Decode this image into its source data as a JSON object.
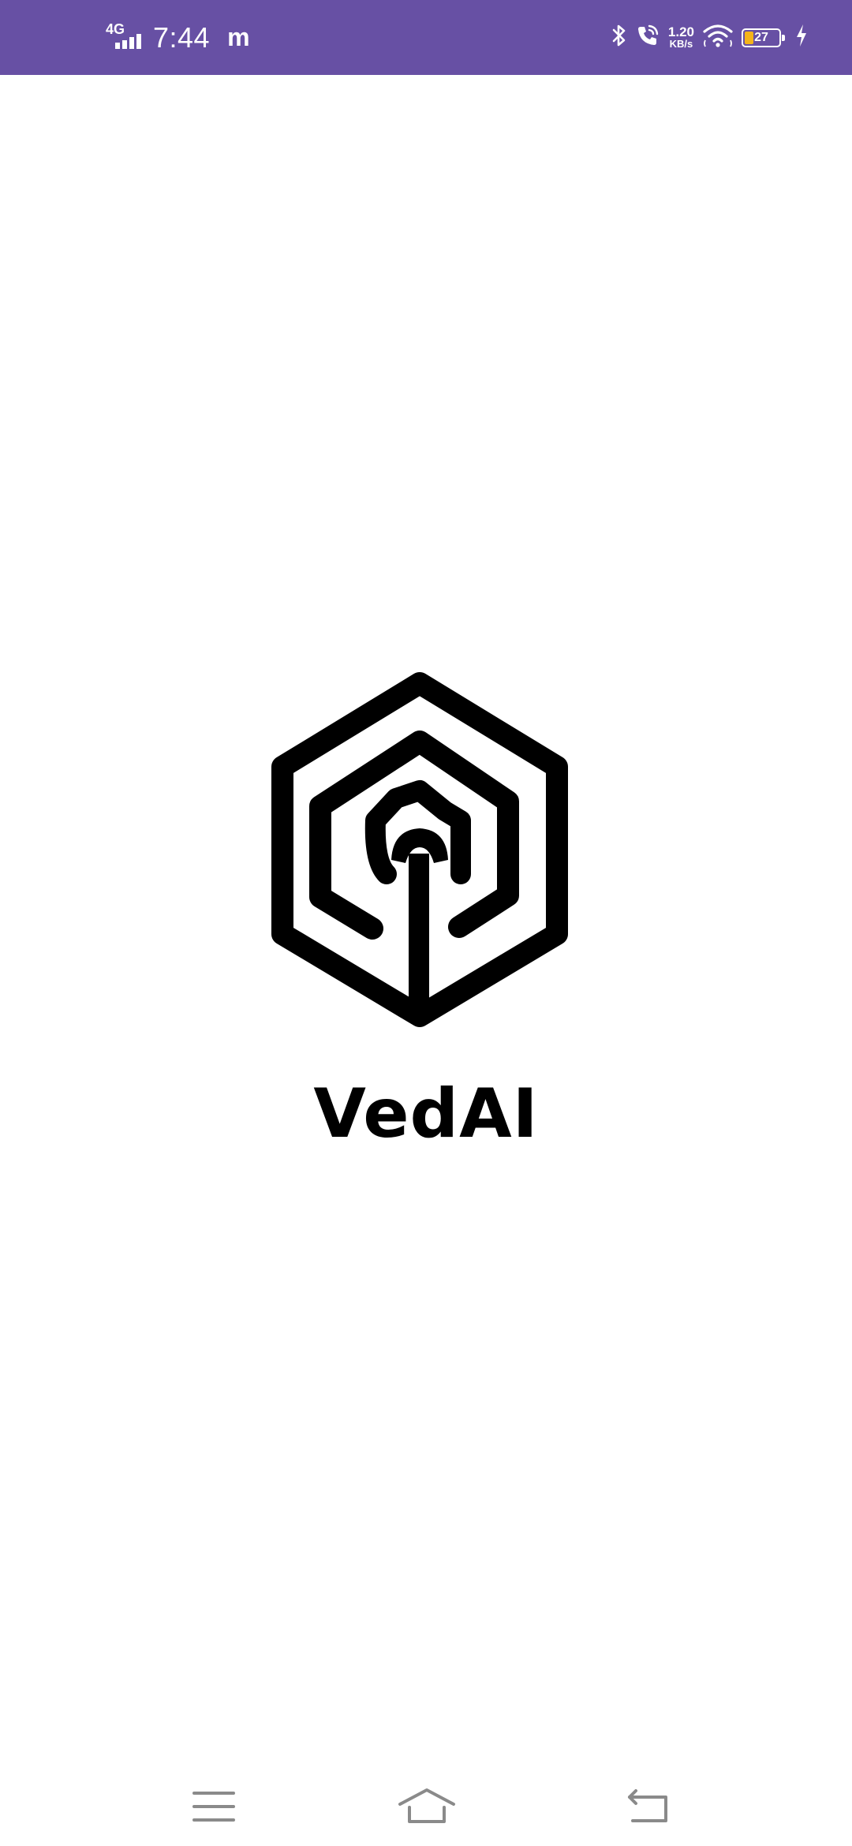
{
  "status_bar": {
    "network": "4G",
    "time": "7:44",
    "notification_glyph": "m",
    "speed_value": "1.20",
    "speed_unit": "KB/s",
    "battery_level": "27",
    "background_color": "#6750a4",
    "icons": [
      "signal-icon",
      "bluetooth-icon",
      "wifi-calling-icon",
      "wifi-hotspot-icon",
      "battery-icon",
      "charging-icon"
    ]
  },
  "splash": {
    "app_name": "VedAI",
    "logo": "vedai-hexagon-logo"
  },
  "nav_bar": {
    "items": [
      "menu-icon",
      "home-icon",
      "back-icon"
    ]
  }
}
